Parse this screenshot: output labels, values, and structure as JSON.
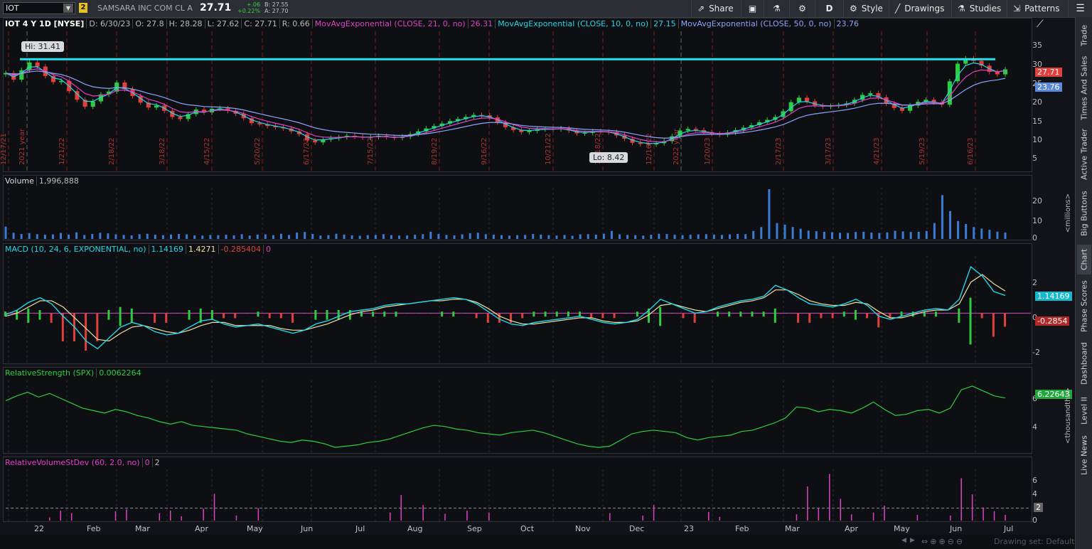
{
  "toolbar": {
    "symbol": "IOT",
    "link_badge": "2",
    "company": "SAMSARA INC COM CL A",
    "last_price": "27.71",
    "change": "+.06",
    "change_pct": "+0.22%",
    "bid": "B: 27.55",
    "ask": "A: 27.70",
    "share_label": "Share",
    "aggregation": "D",
    "style_label": "Style",
    "drawings_label": "Drawings",
    "studies_label": "Studies",
    "patterns_label": "Patterns"
  },
  "price_panel": {
    "title": "IOT 4 Y 1D [NYSE]",
    "date": "D: 6/30/23",
    "open": "O: 27.8",
    "high": "H: 28.28",
    "low": "L: 27.62",
    "close": "C: 27.71",
    "range": "R: 0.66",
    "ema21_label": "MovAvgExponential (CLOSE, 21, 0, no)",
    "ema21_value": "26.31",
    "ema10_label": "MovAvgExponential (CLOSE, 10, 0, no)",
    "ema10_value": "27.15",
    "ema50_label": "MovAvgExponential (CLOSE, 50, 0, no)",
    "ema50_value": "23.76",
    "hi_bubble": "Hi: 31.41",
    "lo_bubble": "Lo: 8.42",
    "last_tag": "27.71",
    "ema50_tag": "23.76",
    "axis_ticks": [
      "35",
      "30",
      "25",
      "20",
      "15",
      "10",
      "5"
    ],
    "vline_labels": [
      "12/17/21",
      "2021 year",
      "1/21/22",
      "2/18/22",
      "3/18/22",
      "4/15/22",
      "5/20/22",
      "6/17/22",
      "7/15/22",
      "8/19/22",
      "9/16/22",
      "10/21/22",
      "11/18/22",
      "12/16/22",
      "2022 year",
      "1/20/23",
      "2/17/23",
      "3/17/23",
      "4/21/23",
      "5/19/23",
      "6/16/23"
    ]
  },
  "volume_panel": {
    "title": "Volume",
    "value": "1,996,888",
    "axis_ticks": [
      "20",
      "10",
      "0"
    ],
    "unit": "<millions>"
  },
  "macd_panel": {
    "title": "MACD (10, 24, 6, EXPONENTIAL, no)",
    "value": "1.14169",
    "avg": "1.4271",
    "diff": "-0.285404",
    "zero": "0",
    "axis_ticks": [
      "2",
      "0",
      "-2"
    ],
    "value_tag": "1.14169",
    "diff_tag": "-0.2854"
  },
  "rs_panel": {
    "title": "RelativeStrength (SPX)",
    "value": "0.0062264",
    "axis_ticks": [
      "6",
      "4"
    ],
    "value_tag": "6.22643",
    "unit": "<thousandths>"
  },
  "rvol_panel": {
    "title": "RelativeVolumeStDev (60, 2.0, no)",
    "value": "0",
    "threshold": "2",
    "axis_ticks": [
      "6",
      "4",
      "2",
      "0"
    ],
    "threshold_tag": "2"
  },
  "x_axis": [
    "22",
    "Feb",
    "Mar",
    "Apr",
    "May",
    "Jun",
    "Jul",
    "Aug",
    "Sep",
    "Oct",
    "Nov",
    "Dec",
    "23",
    "Feb",
    "Mar",
    "Apr",
    "May",
    "Jun",
    "Jul"
  ],
  "sidebar_tabs": [
    "Trade",
    "Times And Sales",
    "Active Trader",
    "Big Buttons",
    "Chart",
    "Phase Scores",
    "Dashboard",
    "Level II",
    "Live News"
  ],
  "footer": {
    "drawing_set": "Drawing set: Default"
  },
  "colors": {
    "up": "#2ecc40",
    "down": "#e0403c",
    "ema10": "#22d6e8",
    "ema21": "#e040c8",
    "ema50": "#8aa4ff",
    "resistance": "#28e0ea"
  },
  "chart_data": {
    "type": "candlestick",
    "resistance_level": 30.2,
    "price_ylim": [
      3,
      37
    ],
    "price_close": [
      26.8,
      25.2,
      27.5,
      29.4,
      28.4,
      26.1,
      24.6,
      24.9,
      22.4,
      20.3,
      18.6,
      19.9,
      21.6,
      22.3,
      24.5,
      22.9,
      21.2,
      19.6,
      18.4,
      18.9,
      17.6,
      16.1,
      15.6,
      16.8,
      17.9,
      17.2,
      18.1,
      18.2,
      17.6,
      16.9,
      15.8,
      14.6,
      14.3,
      13.9,
      13.6,
      13.3,
      12.6,
      11.9,
      10.4,
      9.9,
      10.6,
      10.9,
      11.2,
      11.5,
      11.3,
      11.1,
      11.2,
      11.5,
      11.2,
      11.0,
      11.3,
      11.9,
      12.6,
      13.3,
      13.9,
      14.5,
      15.1,
      15.6,
      16.1,
      16.6,
      16.5,
      16.0,
      14.8,
      13.6,
      12.9,
      12.4,
      12.7,
      13.1,
      13.2,
      13.1,
      13.3,
      12.8,
      12.1,
      12.2,
      12.6,
      12.5,
      12.4,
      11.6,
      10.8,
      9.8,
      9.5,
      9.4,
      9.7,
      10.2,
      11.4,
      12.8,
      13.2,
      12.9,
      12.4,
      12.0,
      11.8,
      12.3,
      12.9,
      13.5,
      14.1,
      14.8,
      15.4,
      16.1,
      17.5,
      19.7,
      20.8,
      19.9,
      18.9,
      18.6,
      18.8,
      19.0,
      19.4,
      20.3,
      21.5,
      21.9,
      20.9,
      19.4,
      18.3,
      17.6,
      18.9,
      19.8,
      20.3,
      19.7,
      19.1,
      24.8,
      29.1,
      30.4,
      29.8,
      28.6,
      27.1,
      26.5,
      27.71
    ],
    "volume_millions": [
      6.2,
      3.1,
      2.5,
      2.9,
      2.4,
      2.1,
      2.3,
      3.0,
      2.2,
      3.3,
      2.0,
      2.5,
      3.1,
      2.8,
      2.3,
      2.0,
      1.8,
      2.4,
      2.6,
      2.1,
      1.9,
      2.2,
      2.5,
      2.3,
      1.8,
      1.7,
      2.0,
      1.9,
      2.1,
      1.8,
      2.4,
      1.7,
      2.2,
      2.3,
      1.9,
      2.6,
      2.0,
      3.2,
      3.5,
      2.5,
      1.7,
      1.9,
      2.6,
      2.2,
      1.8,
      1.6,
      1.9,
      2.0,
      2.4,
      1.9,
      1.7,
      1.8,
      2.1,
      2.4,
      3.6,
      2.5,
      2.0,
      1.8,
      2.3,
      2.9,
      3.1,
      2.4,
      2.2,
      1.9,
      1.7,
      1.9,
      2.0,
      2.5,
      2.2,
      1.9,
      1.7,
      2.0,
      1.6,
      2.3,
      2.4,
      2.2,
      2.6,
      4.0,
      2.3,
      2.0,
      1.9,
      1.7,
      2.1,
      2.6,
      2.5,
      2.1,
      1.9,
      2.1,
      2.3,
      2.4,
      2.2,
      2.0,
      2.3,
      2.5,
      2.4,
      4.0,
      6.0,
      25.0,
      8.0,
      7.2,
      6.0,
      5.1,
      4.2,
      3.9,
      3.6,
      3.4,
      3.1,
      3.0,
      3.5,
      3.6,
      3.2,
      3.0,
      3.3,
      4.1,
      3.8,
      3.5,
      3.6,
      4.0,
      8.0,
      22.0,
      14.0,
      9.0,
      7.5,
      6.0,
      5.2,
      4.6,
      3.7,
      3.2
    ],
    "macd_ylim": [
      -3.2,
      3.6
    ],
    "macd_value": [
      -0.1,
      0.2,
      0.7,
      1.0,
      0.6,
      -0.2,
      -0.9,
      -1.8,
      -2.3,
      -1.6,
      -0.9,
      -0.6,
      -0.8,
      -1.2,
      -1.4,
      -1.3,
      -0.9,
      -0.5,
      -0.4,
      -0.7,
      -0.9,
      -0.8,
      -0.7,
      -0.9,
      -1.1,
      -1.3,
      -1.1,
      -0.7,
      -0.5,
      -0.2,
      0.1,
      0.2,
      0.3,
      0.5,
      0.6,
      0.6,
      0.7,
      0.8,
      0.9,
      1.0,
      0.9,
      0.6,
      0.1,
      -0.4,
      -0.7,
      -0.8,
      -0.6,
      -0.5,
      -0.4,
      -0.3,
      -0.2,
      -0.4,
      -0.6,
      -0.7,
      -0.6,
      -0.4,
      0.2,
      0.9,
      0.6,
      0.3,
      0.0,
      0.1,
      0.4,
      0.6,
      0.8,
      0.9,
      1.1,
      1.8,
      1.5,
      1.0,
      0.6,
      0.5,
      0.4,
      0.6,
      0.9,
      0.5,
      -0.2,
      -0.4,
      -0.2,
      0.0,
      0.2,
      0.3,
      0.2,
      0.9,
      3.0,
      2.4,
      1.4,
      1.14169
    ],
    "macd_avg": [
      -0.2,
      0.0,
      0.4,
      0.8,
      0.8,
      0.4,
      -0.3,
      -1.0,
      -1.7,
      -1.8,
      -1.3,
      -0.9,
      -0.8,
      -1.0,
      -1.2,
      -1.3,
      -1.1,
      -0.8,
      -0.6,
      -0.6,
      -0.8,
      -0.8,
      -0.8,
      -0.8,
      -1.0,
      -1.1,
      -1.1,
      -0.9,
      -0.7,
      -0.4,
      -0.1,
      0.1,
      0.2,
      0.4,
      0.5,
      0.6,
      0.7,
      0.8,
      0.8,
      0.9,
      0.9,
      0.7,
      0.3,
      -0.2,
      -0.5,
      -0.7,
      -0.7,
      -0.6,
      -0.5,
      -0.4,
      -0.3,
      -0.3,
      -0.5,
      -0.6,
      -0.6,
      -0.5,
      -0.1,
      0.5,
      0.6,
      0.4,
      0.2,
      0.1,
      0.3,
      0.5,
      0.7,
      0.8,
      1.0,
      1.5,
      1.5,
      1.2,
      0.8,
      0.6,
      0.5,
      0.5,
      0.7,
      0.6,
      0.1,
      -0.3,
      -0.3,
      -0.1,
      0.1,
      0.2,
      0.2,
      0.6,
      2.0,
      2.5,
      1.9,
      1.4271
    ],
    "rs_thousandths": [
      6.0,
      6.4,
      6.7,
      6.3,
      6.6,
      6.2,
      5.8,
      5.4,
      5.2,
      5.0,
      5.3,
      5.1,
      4.8,
      4.6,
      4.3,
      4.1,
      4.3,
      4.0,
      3.9,
      3.8,
      3.7,
      3.6,
      3.3,
      3.1,
      2.9,
      2.7,
      2.6,
      2.8,
      2.7,
      2.5,
      2.2,
      2.3,
      2.4,
      2.6,
      2.7,
      2.9,
      3.2,
      3.5,
      3.8,
      4.0,
      3.9,
      3.7,
      3.6,
      3.4,
      3.3,
      3.2,
      3.4,
      3.5,
      3.6,
      3.4,
      3.1,
      2.8,
      2.5,
      2.3,
      2.2,
      2.3,
      2.8,
      3.3,
      3.5,
      3.6,
      3.5,
      3.4,
      3.0,
      2.8,
      3.0,
      3.1,
      3.2,
      3.5,
      3.6,
      3.9,
      4.2,
      4.6,
      5.5,
      5.4,
      5.1,
      5.3,
      5.2,
      5.0,
      5.4,
      5.9,
      5.3,
      4.8,
      4.9,
      5.2,
      5.3,
      5.0,
      5.4,
      6.9,
      7.2,
      6.8,
      6.4,
      6.22643
    ],
    "rvol_values": [
      0,
      0,
      0,
      0,
      0.5,
      1.6,
      1.2,
      0,
      0,
      0,
      1.5,
      1.8,
      0,
      0,
      1.2,
      1.6,
      0.7,
      0,
      1.9,
      4.3,
      0,
      0.8,
      0,
      2.0,
      0,
      0,
      0,
      0,
      0,
      0,
      0,
      0,
      0,
      0,
      0,
      1.3,
      4.1,
      0,
      2.5,
      0,
      1.1,
      0,
      1.6,
      0,
      1.3,
      0,
      0,
      0,
      0,
      0,
      0,
      0,
      0,
      0,
      0,
      1.2,
      0,
      0,
      0.8,
      2.5,
      0,
      0,
      0,
      0,
      1.4,
      0.6,
      0,
      0,
      0,
      0,
      0,
      0,
      1.0,
      5.5,
      2.0,
      7.5,
      3.5,
      1.0,
      0,
      1.3,
      2.4,
      0,
      0,
      0.9,
      0,
      0,
      0.8,
      6.8,
      4.2,
      2.1,
      1.5,
      0.9
    ],
    "rvol_threshold": 2
  }
}
